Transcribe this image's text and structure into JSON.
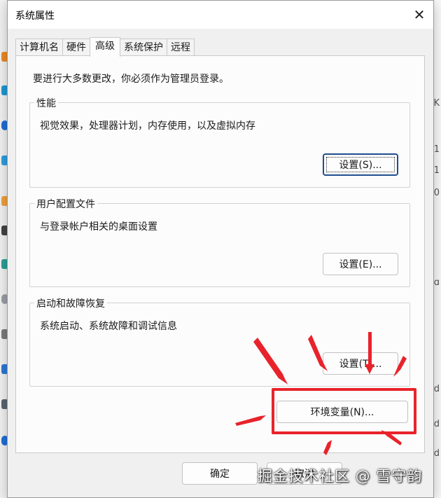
{
  "dialog": {
    "title": "系统属性",
    "close_glyph": "✕",
    "tabs": [
      {
        "label": "计算机名",
        "active": false
      },
      {
        "label": "硬件",
        "active": false
      },
      {
        "label": "高级",
        "active": true
      },
      {
        "label": "系统保护",
        "active": false
      },
      {
        "label": "远程",
        "active": false
      }
    ],
    "admin_note": "要进行大多数更改，你必须作为管理员登录。",
    "performance": {
      "label": "性能",
      "description": "视觉效果，处理器计划，内存使用，以及虚拟内存",
      "settings_button": "设置(S)..."
    },
    "user_profiles": {
      "label": "用户配置文件",
      "description": "与登录帐户相关的桌面设置",
      "settings_button": "设置(E)..."
    },
    "startup_recovery": {
      "label": "启动和故障恢复",
      "description": "系统启动、系统故障和调试信息",
      "settings_button": "设置(T)..."
    },
    "env_vars_button": "环境变量(N)...",
    "ok_button": "确定",
    "cancel_button": "取消"
  },
  "background": {
    "right_glyphs": [
      "K",
      "1",
      "1",
      "0",
      "ɑ",
      "d",
      "d",
      "d"
    ]
  },
  "annotation": {
    "highlight_color": "#e8232b",
    "watermark": "掘金技术社区 @ 雪守韵"
  }
}
